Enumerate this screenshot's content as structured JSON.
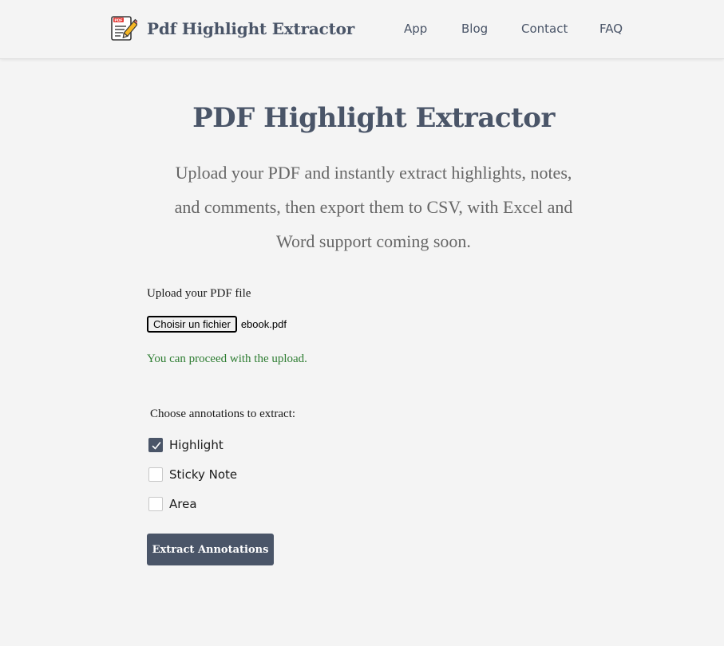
{
  "header": {
    "brand_name": "Pdf Highlight Extractor",
    "logo_icon": "pdf-document-pencil-icon",
    "nav": [
      {
        "label": "App"
      },
      {
        "label": "Blog"
      },
      {
        "label": "Contact"
      },
      {
        "label": "FAQ"
      }
    ]
  },
  "hero": {
    "title": "PDF Highlight Extractor",
    "subtitle_lines": [
      "Upload your PDF and instantly extract highlights, notes,",
      "and comments, then export them to CSV, with Excel and",
      "Word support coming soon."
    ]
  },
  "upload": {
    "label": "Upload your PDF file",
    "button_label": "Choisir un fichier",
    "file_name": "ebook.pdf",
    "status_message": "You can proceed with the upload."
  },
  "annotations": {
    "heading": "Choose annotations to extract:",
    "options": [
      {
        "label": "Highlight",
        "checked": true
      },
      {
        "label": "Sticky Note",
        "checked": false
      },
      {
        "label": "Area",
        "checked": false
      }
    ]
  },
  "actions": {
    "extract_label": "Extract Annotations"
  },
  "colors": {
    "primary": "#4a5568",
    "background": "#f4f4f4",
    "success": "#2e7d32",
    "logo_red": "#e53935",
    "logo_pencil": "#f5b623"
  }
}
